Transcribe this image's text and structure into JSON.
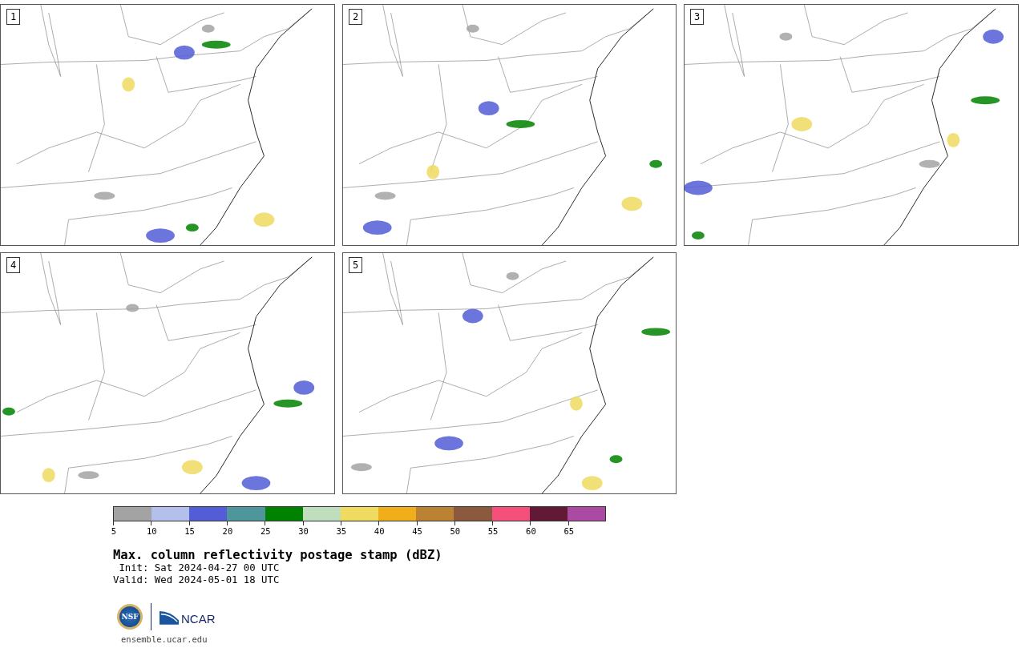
{
  "panels": [
    {
      "label": "1"
    },
    {
      "label": "2"
    },
    {
      "label": "3"
    },
    {
      "label": "4"
    },
    {
      "label": "5"
    }
  ],
  "colorbar": {
    "bins": [
      {
        "tick": "5",
        "color": "#a3a3a3"
      },
      {
        "tick": "10",
        "color": "#b5bfec"
      },
      {
        "tick": "15",
        "color": "#525dd6"
      },
      {
        "tick": "20",
        "color": "#4e969c"
      },
      {
        "tick": "25",
        "color": "#008200"
      },
      {
        "tick": "30",
        "color": "#bedebe"
      },
      {
        "tick": "35",
        "color": "#efdb5f"
      },
      {
        "tick": "40",
        "color": "#efae1a"
      },
      {
        "tick": "45",
        "color": "#bc8233"
      },
      {
        "tick": "50",
        "color": "#8b5a3e"
      },
      {
        "tick": "55",
        "color": "#f5507c"
      },
      {
        "tick": "60",
        "color": "#621935"
      },
      {
        "tick": "65",
        "color": "#ab4aa3"
      }
    ]
  },
  "title": "Max. column reflectivity postage stamp (dBZ)",
  "init": " Init: Sat 2024-04-27 00 UTC",
  "valid": "Valid: Wed 2024-05-01 18 UTC",
  "logos": {
    "nsf": "NSF",
    "ncar": "NCAR"
  },
  "url": "ensemble.ucar.edu"
}
